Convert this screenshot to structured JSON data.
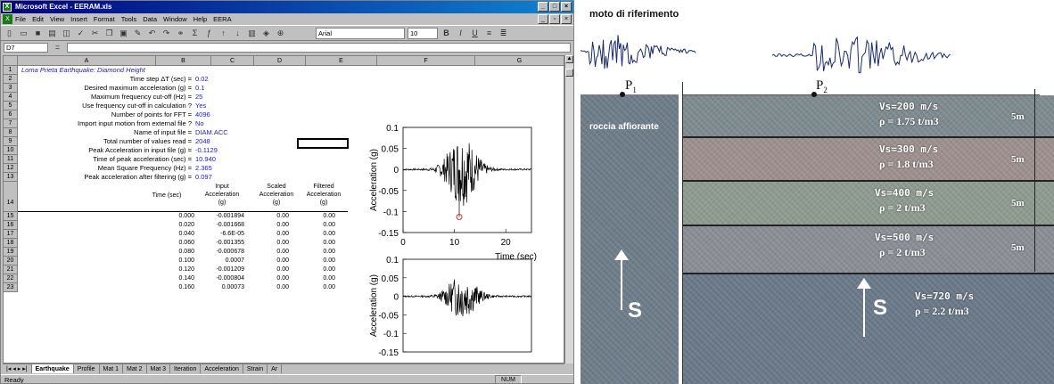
{
  "excel": {
    "title": "Microsoft Excel - EERAM.xls",
    "menu": [
      "File",
      "Edit",
      "View",
      "Insert",
      "Format",
      "Tools",
      "Data",
      "Window",
      "Help",
      "EERA"
    ],
    "font_name": "Arial",
    "font_size": "10",
    "name_box": "D7",
    "columns": [
      "A",
      "B",
      "C",
      "D",
      "E",
      "F",
      "G"
    ],
    "sheet_title": "Loma Prieta Earthquake: Diamond Height",
    "params": [
      {
        "row": "2",
        "label": "Time step ΔT (sec) =",
        "value": "0.02"
      },
      {
        "row": "3",
        "label": "Desired maximum acceleration (g) =",
        "value": "0.1"
      },
      {
        "row": "4",
        "label": "Maximum frequency cut-off (Hz) =",
        "value": "25"
      },
      {
        "row": "5",
        "label": "Use frequency cut-off in calculation ?",
        "value": "Yes"
      },
      {
        "row": "6",
        "label": "Number of points for FFT =",
        "value": "4096"
      },
      {
        "row": "7",
        "label": "Import input motion from external file ?",
        "value": "No"
      },
      {
        "row": "8",
        "label": "Name of input file =",
        "value": "DIAM.ACC"
      },
      {
        "row": "9",
        "label": "Total number of values read =",
        "value": "2048"
      },
      {
        "row": "10",
        "label": "Peak Acceleration in input file (g) =",
        "value": "-0.1129"
      },
      {
        "row": "11",
        "label": "Time of peak acceleration (sec) =",
        "value": "10.940"
      },
      {
        "row": "12",
        "label": "Mean Square Frequency (Hz) =",
        "value": "2.365"
      },
      {
        "row": "13",
        "label": "Peak acceleration after filtering (g) =",
        "value": "0.097"
      }
    ],
    "row14": "14",
    "table_headers": {
      "time": "Time (sec)",
      "input": [
        "Input",
        "Acceleration",
        "(g)"
      ],
      "scaled": [
        "Scaled",
        "Acceleration",
        "(g)"
      ],
      "filtered": [
        "Filtered",
        "Acceleration",
        "(g)"
      ]
    },
    "table_rows": [
      {
        "row": "15",
        "time": "0.000",
        "input": "-0.001894",
        "scaled": "0.00",
        "filtered": "0.00"
      },
      {
        "row": "16",
        "time": "0.020",
        "input": "-0.001668",
        "scaled": "0.00",
        "filtered": "0.00"
      },
      {
        "row": "17",
        "time": "0.040",
        "input": "-6.6E-05",
        "scaled": "0.00",
        "filtered": "0.00"
      },
      {
        "row": "18",
        "time": "0.060",
        "input": "-0.001355",
        "scaled": "0.00",
        "filtered": "0.00"
      },
      {
        "row": "19",
        "time": "0.080",
        "input": "-0.000678",
        "scaled": "0.00",
        "filtered": "0.00"
      },
      {
        "row": "20",
        "time": "0.100",
        "input": "0.0007",
        "scaled": "0.00",
        "filtered": "0.00"
      },
      {
        "row": "21",
        "time": "0.120",
        "input": "-0.001209",
        "scaled": "0.00",
        "filtered": "0.00"
      },
      {
        "row": "22",
        "time": "0.140",
        "input": "-0.000804",
        "scaled": "0.00",
        "filtered": "0.00"
      },
      {
        "row": "23",
        "time": "0.160",
        "input": "0.00073",
        "scaled": "0.00",
        "filtered": "0.00"
      }
    ],
    "sheets": [
      "Earthquake",
      "Profile",
      "Mat 1",
      "Mat 2",
      "Mat 3",
      "Iteration",
      "Acceleration",
      "Strain",
      "Ar"
    ],
    "status": "Ready",
    "status_num": "NUM"
  },
  "chart_data": [
    {
      "type": "line",
      "ylabel": "Acceleration (g)",
      "xlabel": "Time (sec)",
      "xlim": [
        0,
        25
      ],
      "ylim": [
        -0.15,
        0.1
      ],
      "yticks": [
        "0.1",
        "0.05",
        "0",
        "-0.05",
        "-0.1",
        "-0.15"
      ],
      "xticks": [
        "0",
        "10",
        "20"
      ],
      "peak": {
        "x": 10.94,
        "y": -0.1129
      }
    },
    {
      "type": "line",
      "ylabel": "Acceleration (g)",
      "ylim": [
        -0.15,
        0.1
      ],
      "yticks": [
        "0.1",
        "0.05",
        "0",
        "-0.05",
        "-0.1",
        "-0.15"
      ]
    }
  ],
  "soil": {
    "title": "moto di riferimento",
    "p1": "P",
    "p1_sub": "1",
    "p2": "P",
    "p2_sub": "2",
    "rock_label": "roccia affiorante",
    "layers": [
      {
        "vs": "Vs=200 m/s",
        "rho": "ρ = 1.75 t/m3",
        "thickness": "5m",
        "color": "#7d8a8e"
      },
      {
        "vs": "Vs=300 m/s",
        "rho": "ρ = 1.8  t/m3",
        "thickness": "5m",
        "color": "#9d8f8e"
      },
      {
        "vs": "Vs=400 m/s",
        "rho": "ρ =  2  t/m3",
        "thickness": "5m",
        "color": "#8d9a90"
      },
      {
        "vs": "Vs=500 m/s",
        "rho": "ρ =  2  t/m3",
        "thickness": "5m",
        "color": "#8b8d95"
      }
    ],
    "bedrock": {
      "vs": "Vs=720 m/s",
      "rho": "ρ = 2.2 t/m3",
      "s": "S"
    },
    "rock_s": "S",
    "rock_color": "#6d7c88",
    "bedrock_color": "#6a7888"
  }
}
